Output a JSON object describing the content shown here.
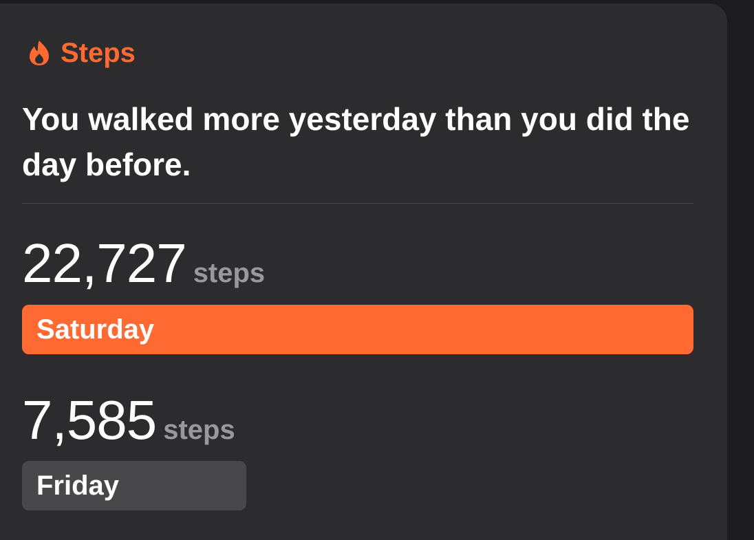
{
  "card": {
    "title": "Steps",
    "icon": "flame-icon",
    "headline": "You walked more yesterday than you did the day before."
  },
  "colors": {
    "accent": "#ff6a33",
    "card_bg": "#2c2c2e",
    "secondary_bar": "#48484a",
    "unit_text": "#98989f"
  },
  "comparison": [
    {
      "value": "22,727",
      "unit": "steps",
      "day": "Saturday",
      "bar_fraction": 1.0,
      "color": "#ff6a33"
    },
    {
      "value": "7,585",
      "unit": "steps",
      "day": "Friday",
      "bar_fraction": 0.334,
      "color": "#48484a"
    }
  ]
}
